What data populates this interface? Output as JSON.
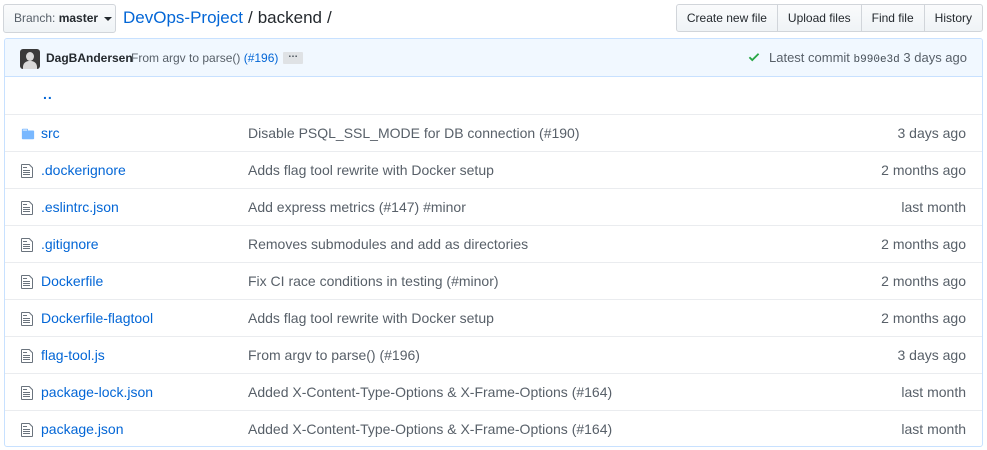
{
  "branch": {
    "label": "Branch:",
    "name": "master"
  },
  "breadcrumb": {
    "repo": "DevOps-Project",
    "separator": "/",
    "current": "backend",
    "trailing": "/"
  },
  "actions": [
    "Create new file",
    "Upload files",
    "Find file",
    "History"
  ],
  "latest_commit": {
    "author": "DagBAndersen",
    "message": "From argv to parse()",
    "pr": "(#196)",
    "ellipsis": "…",
    "status": "Latest commit",
    "sha": "b990e3d",
    "age": "3 days ago"
  },
  "parent_link": "..",
  "files": [
    {
      "type": "folder",
      "name": "src",
      "message": "Disable PSQL_SSL_MODE for DB connection (#190)",
      "age": "3 days ago"
    },
    {
      "type": "file",
      "name": ".dockerignore",
      "message": "Adds flag tool rewrite with Docker setup",
      "age": "2 months ago"
    },
    {
      "type": "file",
      "name": ".eslintrc.json",
      "message": "Add express metrics (#147) #minor",
      "age": "last month"
    },
    {
      "type": "file",
      "name": ".gitignore",
      "message": "Removes submodules and add as directories",
      "age": "2 months ago"
    },
    {
      "type": "file",
      "name": "Dockerfile",
      "message": "Fix CI race conditions in testing (#minor)",
      "age": "2 months ago"
    },
    {
      "type": "file",
      "name": "Dockerfile-flagtool",
      "message": "Adds flag tool rewrite with Docker setup",
      "age": "2 months ago"
    },
    {
      "type": "file",
      "name": "flag-tool.js",
      "message": "From argv to parse() (#196)",
      "age": "3 days ago"
    },
    {
      "type": "file",
      "name": "package-lock.json",
      "message": "Added X-Content-Type-Options & X-Frame-Options (#164)",
      "age": "last month"
    },
    {
      "type": "file",
      "name": "package.json",
      "message": "Added X-Content-Type-Options & X-Frame-Options (#164)",
      "age": "last month"
    }
  ],
  "colors": {
    "link": "#0366d6",
    "muted": "#586069",
    "success": "#28a745",
    "icon": "#6a737d",
    "box_border": "#c8e1ff",
    "tease_bg": "#f1f8ff"
  }
}
